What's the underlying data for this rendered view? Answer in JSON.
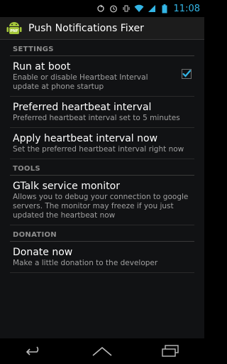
{
  "status": {
    "time": "11:08"
  },
  "app": {
    "title": "Push Notifications Fixer",
    "icon_label": "PNF"
  },
  "sections": [
    {
      "header": "SETTINGS",
      "items": [
        {
          "title": "Run at boot",
          "summary": "Enable or disable Heartbeat Interval update at phone startup",
          "checked": true
        },
        {
          "title": "Preferred heartbeat interval",
          "summary": "Preferred heartbeat interval set to 5 minutes"
        },
        {
          "title": "Apply heartbeat interval now",
          "summary": "Set the preferred heartbeat interval right now"
        }
      ]
    },
    {
      "header": "TOOLS",
      "items": [
        {
          "title": "GTalk service monitor",
          "summary": "Allows you to debug your connection to google servers. The monitor may freeze if you just updated the heartbeat now"
        }
      ]
    },
    {
      "header": "DONATION",
      "items": [
        {
          "title": "Donate now",
          "summary": "Make a little donation to the developer"
        }
      ]
    }
  ],
  "colors": {
    "accent": "#33b5e5",
    "background": "#111214",
    "actionbar": "#1c1c1c"
  },
  "icons": {
    "status": [
      "sync-icon",
      "alarm-icon",
      "vibrate-icon",
      "wifi-icon",
      "signal-icon",
      "battery-icon"
    ],
    "nav": [
      "back-icon",
      "home-icon",
      "recent-apps-icon"
    ]
  }
}
